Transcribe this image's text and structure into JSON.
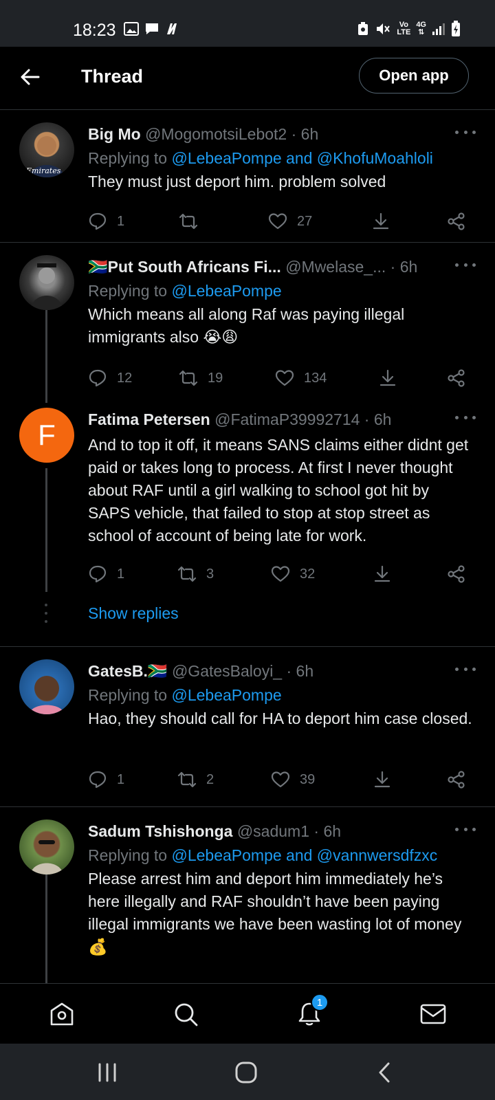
{
  "status_bar": {
    "time": "18:23",
    "network_label_top": "Vo",
    "network_label_bottom": "LTE",
    "network_gen": "4G"
  },
  "header": {
    "title": "Thread",
    "open_app_label": "Open app"
  },
  "tweets": [
    {
      "name": "Big Mo",
      "handle": "@MogomotsiLebot2",
      "time": "· 6h",
      "replying_prefix": "Replying to ",
      "replying_mentions": "@LebeaPompe and @KhofuMoahloli",
      "text": "They must just deport him. problem solved",
      "replies": "1",
      "retweets": "",
      "likes": "27"
    },
    {
      "name": "🇿🇦Put South Africans Fi...",
      "handle": "@Mwelase_...",
      "time": "· 6h",
      "replying_prefix": "Replying to ",
      "replying_mentions": "@LebeaPompe",
      "text": "Which means all along Raf was paying illegal immigrants also 😭😩",
      "replies": "12",
      "retweets": "19",
      "likes": "134"
    },
    {
      "name": "Fatima Petersen",
      "handle": "@FatimaP39992714",
      "time": "· 6h",
      "avatar_letter": "F",
      "text": "And to top it off, it means SANS claims either didnt get paid or takes long to process. At first I never thought about RAF until a girl walking to school got hit by SAPS vehicle,  that failed to stop at stop street as school of account of being late for work.",
      "replies": "1",
      "retweets": "3",
      "likes": "32",
      "show_replies": "Show replies"
    },
    {
      "name": "GatesB.🇿🇦",
      "handle": "@GatesBaloyi_",
      "time": "· 6h",
      "replying_prefix": "Replying to ",
      "replying_mentions": "@LebeaPompe",
      "text": "Hao, they should call for HA to deport him case closed.",
      "replies": "1",
      "retweets": "2",
      "likes": "39"
    },
    {
      "name": "Sadum Tshishonga",
      "handle": "@sadum1",
      "time": "· 6h",
      "replying_prefix": "Replying to ",
      "replying_mentions": "@LebeaPompe and @vannwersdfzxc",
      "text": "Please arrest him and deport him immediately he’s here illegally and RAF shouldn’t have been paying illegal immigrants we have been wasting lot of money 💰"
    }
  ],
  "bottom_nav": {
    "notification_count": "1"
  },
  "colors": {
    "background": "#000000",
    "accent": "#1d9bf0",
    "muted": "#71767b",
    "text": "#e7e9ea",
    "fatima_avatar": "#f4670f"
  }
}
